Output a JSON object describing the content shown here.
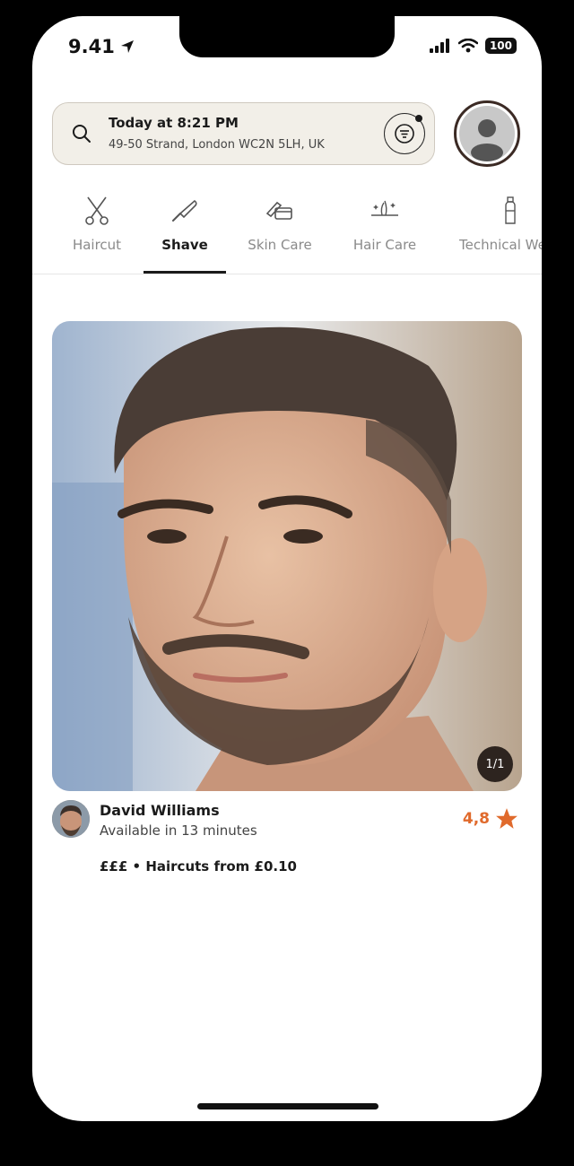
{
  "status_bar": {
    "time": "9.41",
    "battery": "100"
  },
  "search": {
    "title": "Today at 8:21 PM",
    "address": "49-50 Strand, London WC2N 5LH, UK"
  },
  "categories": [
    {
      "label": "Haircut",
      "icon": "scissors-icon"
    },
    {
      "label": "Shave",
      "icon": "razor-icon",
      "active": true
    },
    {
      "label": "Skin Care",
      "icon": "cream-icon"
    },
    {
      "label": "Hair Care",
      "icon": "sparkle-hair-icon"
    },
    {
      "label": "Technical We",
      "icon": "bottle-icon"
    }
  ],
  "card": {
    "photo_counter": "1/1",
    "barber_name": "David Williams",
    "availability": "Available in 13 minutes",
    "rating": "4,8",
    "price_info": "£££ • Haircuts from £0.10"
  },
  "colors": {
    "accent": "#e06a2c",
    "dark": "#1b1b1b",
    "search_bg": "#f2efe8"
  }
}
